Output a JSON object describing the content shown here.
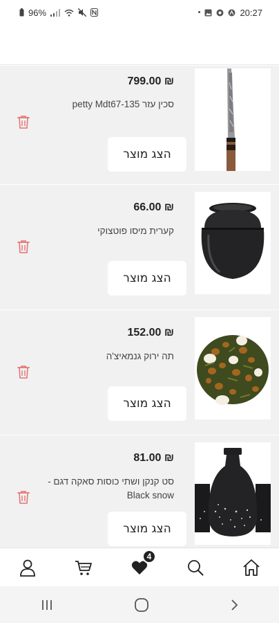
{
  "status": {
    "battery": "96%",
    "time": "20:27"
  },
  "cart_items": [
    {
      "price": "₪ 799.00",
      "name": "סכין עזר petty Mdt67-135",
      "button_label": "הצג מוצר",
      "image": "knife"
    },
    {
      "price": "₪ 66.00",
      "name": "קערית מיסו פוטצוקי",
      "button_label": "הצג מוצר",
      "image": "bowl"
    },
    {
      "price": "₪ 152.00",
      "name": "תה ירוק גנמאיצ'ה",
      "button_label": "הצג מוצר",
      "image": "tea"
    },
    {
      "price": "₪ 81.00",
      "name": "סט קנקן ושתי כוסות סאקה דגם -Black snow",
      "button_label": "הצג מוצר",
      "image": "sake-set"
    }
  ],
  "bottom_nav": {
    "items": [
      "profile",
      "cart",
      "wishlist",
      "search",
      "home"
    ],
    "wishlist_badge": "4"
  },
  "colors": {
    "trash": "#e57373",
    "list_bg": "#f1f1f1",
    "badge_bg": "#222222"
  }
}
